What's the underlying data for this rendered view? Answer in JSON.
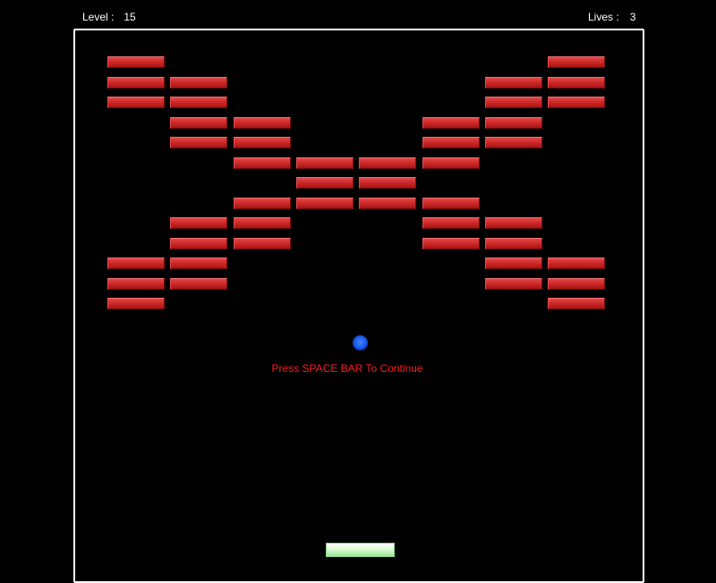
{
  "hud": {
    "level_label": "Level :",
    "level_value": "15",
    "lives_label": "Lives :",
    "lives_value": "3"
  },
  "message": "Press SPACE BAR To Continue",
  "colors": {
    "background": "#000000",
    "border": "#ffffff",
    "brick": "#cf2a2a",
    "ball": "#1d5ff0",
    "paddle": "#b6f0b0",
    "message": "#ff1a1a"
  },
  "bricks": {
    "columns": 8,
    "rows": 13,
    "pattern": [
      "X......X",
      "XX....XX",
      "XX....XX",
      ".XX..XX.",
      ".XX..XX.",
      "..XXXX..",
      "...XX...",
      "..XXXX..",
      ".XX..XX.",
      ".XX..XX.",
      "XX....XX",
      "XX....XX",
      "X......X"
    ]
  }
}
